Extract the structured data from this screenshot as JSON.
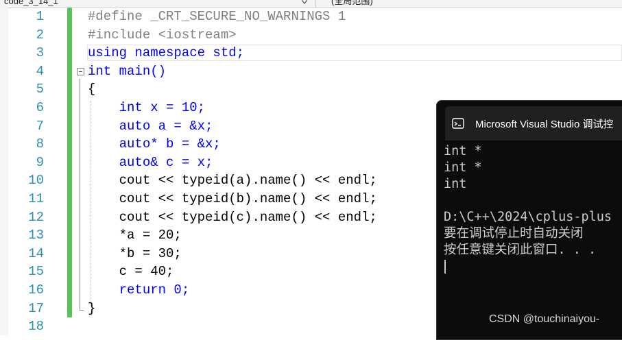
{
  "tabs": {
    "file": "code_3_14_1",
    "scope": "(全局范围)"
  },
  "editor": {
    "line_numbers": [
      "1",
      "2",
      "3",
      "4",
      "5",
      "6",
      "7",
      "8",
      "9",
      "10",
      "11",
      "12",
      "13",
      "14",
      "15",
      "16",
      "17",
      "18"
    ],
    "lines": [
      "#define _CRT_SECURE_NO_WARNINGS 1",
      "#include <iostream>",
      "using namespace std;",
      "int main()",
      "{",
      "    int x = 10;",
      "    auto a = &x;",
      "    auto* b = &x;",
      "    auto& c = x;",
      "    cout << typeid(a).name() << endl;",
      "    cout << typeid(b).name() << endl;",
      "    cout << typeid(c).name() << endl;",
      "    *a = 20;",
      "    *b = 30;",
      "    c = 40;",
      "    return 0;",
      "}",
      ""
    ],
    "colors": {
      "line_number": "#2b91af",
      "keyword": "#0000ff",
      "type": "#2b91af",
      "preprocessor": "#808080",
      "change_bar": "#57c15a"
    }
  },
  "console": {
    "title": "Microsoft Visual Studio 调试控",
    "output": [
      "int *",
      "int *",
      "int",
      "",
      "D:\\C++\\2024\\cplus-plus",
      "要在调试停止时自动关闭",
      "按任意键关闭此窗口. . ."
    ],
    "icon": "terminal-icon",
    "background": "#0c0c0c"
  },
  "watermark": "CSDN @touchinaiyou-"
}
